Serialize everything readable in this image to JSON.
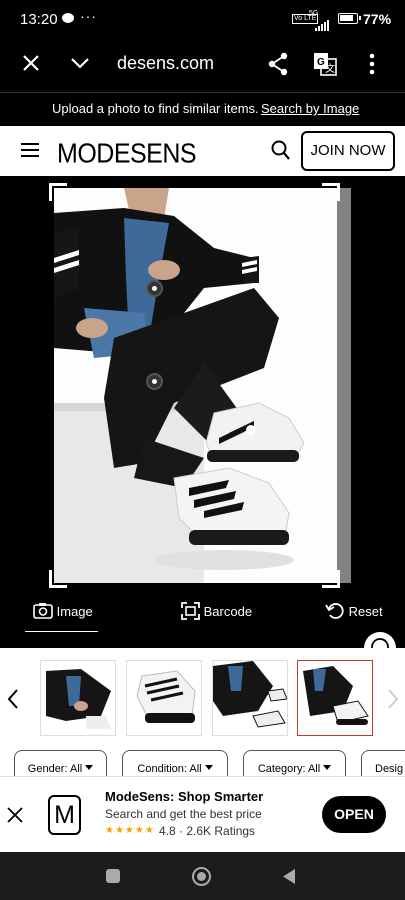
{
  "status_bar": {
    "time": "13:20",
    "volte": "Vo LTE",
    "network": "5G",
    "battery": "77%"
  },
  "browser": {
    "url": "desens.com"
  },
  "notice": {
    "text": "Upload a photo to find similar items.",
    "link": "Search by Image"
  },
  "header": {
    "logo": "MODESENS",
    "join_label": "JOIN NOW"
  },
  "crop_tools": {
    "image_label": "Image",
    "barcode_label": "Barcode",
    "reset_label": "Reset"
  },
  "results": {
    "selected_index": 3,
    "thumbs": 4
  },
  "filters": [
    {
      "label": "Gender: All"
    },
    {
      "label": "Condition: All"
    },
    {
      "label": "Category: All"
    },
    {
      "label": "Desig"
    }
  ],
  "app_banner": {
    "title": "ModeSens: Shop Smarter",
    "subtitle": "Search and get the best price",
    "stars": "★★★★★",
    "rating": "4.8 · 2.6K Ratings",
    "open_label": "OPEN",
    "logo_letter": "M"
  },
  "colors": {
    "accent": "#000000",
    "selected_border": "#c0392b",
    "star": "#f0a500"
  }
}
